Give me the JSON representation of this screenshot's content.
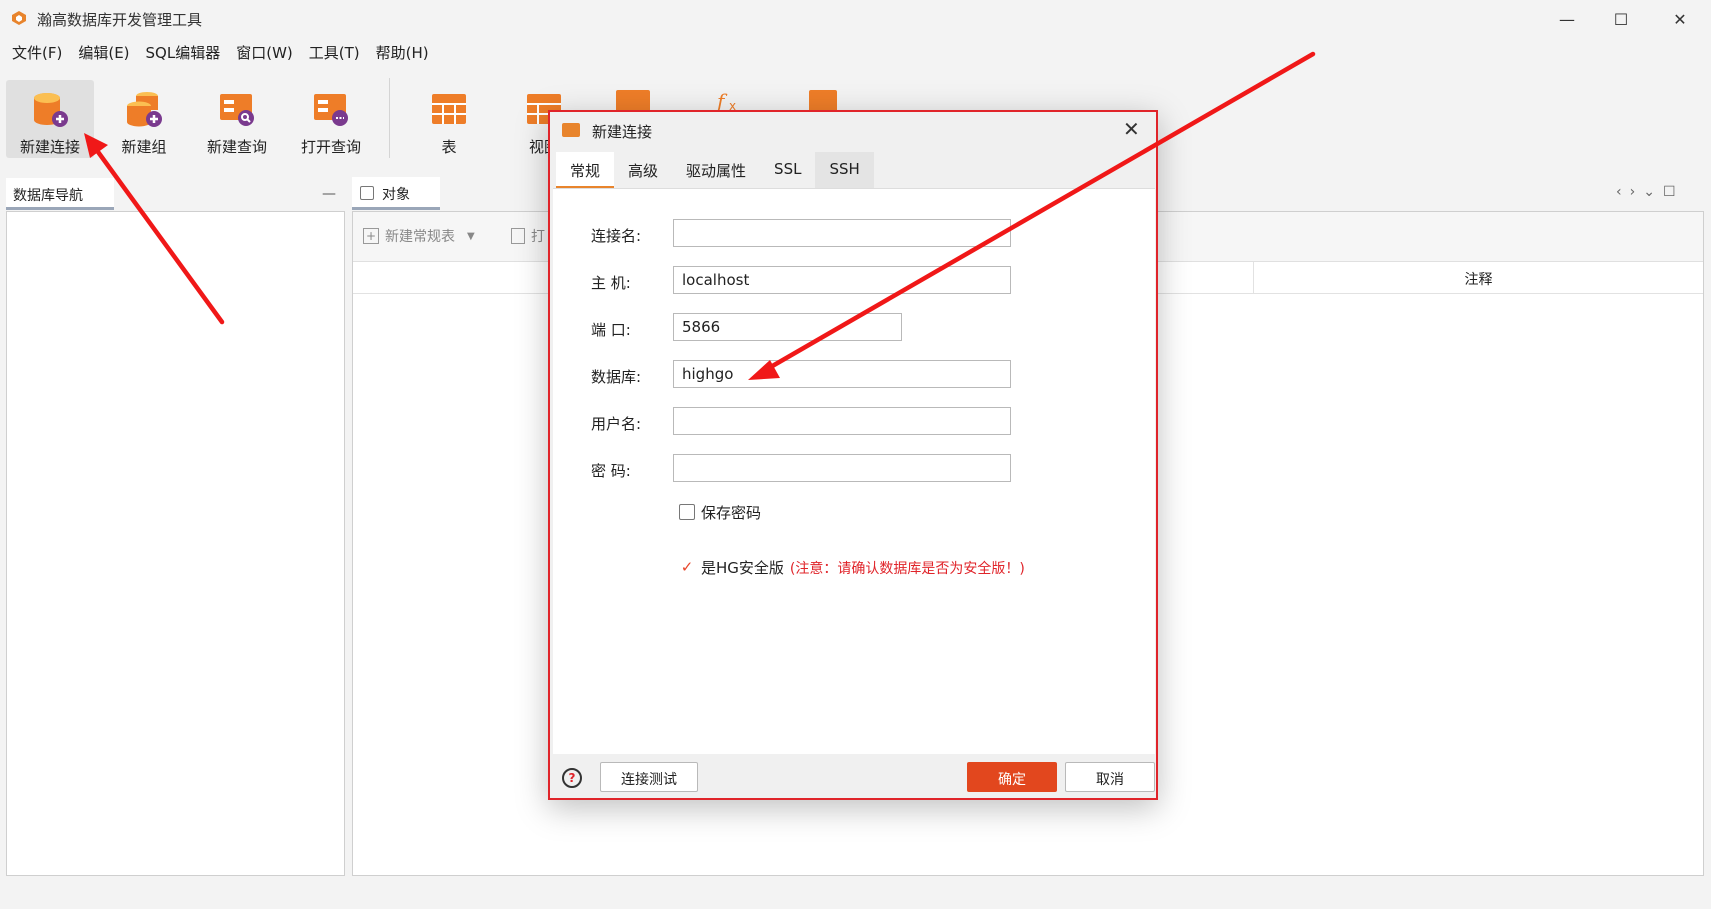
{
  "window": {
    "title": "瀚高数据库开发管理工具",
    "min": "—",
    "max": "☐",
    "close": "✕"
  },
  "menu": [
    "文件(F)",
    "编辑(E)",
    "SQL编辑器",
    "窗口(W)",
    "工具(T)",
    "帮助(H)"
  ],
  "toolbar": {
    "items": [
      "新建连接",
      "新建组",
      "新建查询",
      "打开查询",
      "表",
      "视图"
    ]
  },
  "nav": {
    "tab": "数据库导航",
    "minimize": "—"
  },
  "objects": {
    "tab": "对象",
    "new_table": "新建常规表",
    "open": "打",
    "column_note": "注释",
    "ctrl_prev": "‹",
    "ctrl_next": "›",
    "ctrl_menu": "⌄",
    "ctrl_max": "☐"
  },
  "dialog": {
    "title": "新建连接",
    "close": "✕",
    "tabs": [
      "常规",
      "高级",
      "驱动属性",
      "SSL",
      "SSH"
    ],
    "fields": {
      "name_label": "连接名:",
      "name_value": "",
      "host_label": "主  机:",
      "host_value": "localhost",
      "port_label": "端  口:",
      "port_value": "5866",
      "db_label": "数据库:",
      "db_value": "highgo",
      "user_label": "用户名:",
      "user_value": "",
      "pwd_label": "密  码:",
      "pwd_value": ""
    },
    "save_password": "保存密码",
    "save_password_checked": false,
    "hg_secure": "是HG安全版",
    "hg_secure_checked": true,
    "hg_note": "(注意：请确认数据库是否为安全版！)",
    "help": "?",
    "check_mark": "✓",
    "btn_test": "连接测试",
    "btn_ok": "确定",
    "btn_cancel": "取消"
  },
  "colors": {
    "accent": "#e2471e",
    "highlight_border": "#e0242a",
    "annotation_arrow": "#f01818"
  }
}
